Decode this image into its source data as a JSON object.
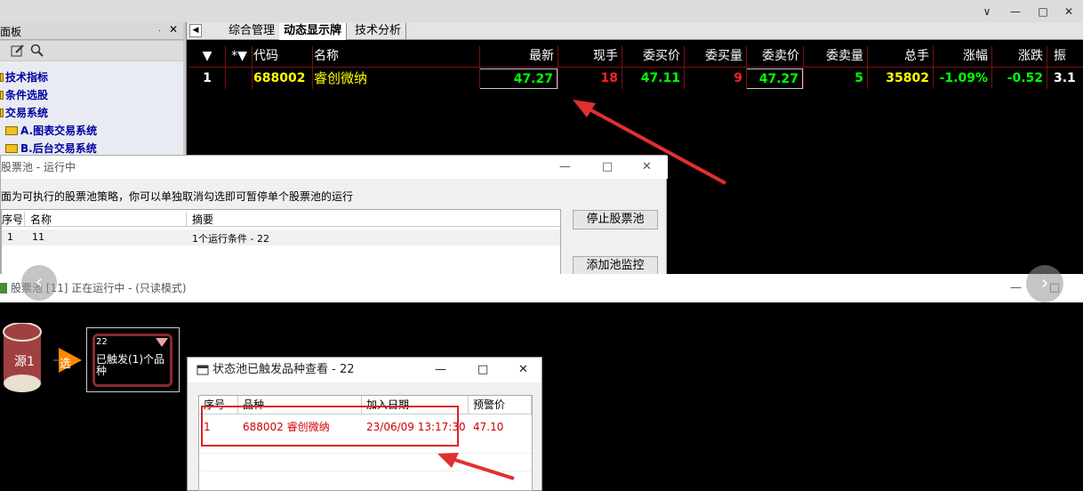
{
  "window": {
    "minimize": "—",
    "restore": "□",
    "close": "✕",
    "chevron": "∨"
  },
  "left_panel": {
    "title": "面板",
    "pin": "ᆞ",
    "close": "✕",
    "items": [
      "技术指标",
      "条件选股",
      "交易系统",
      "A.图表交易系统",
      "B.后台交易系统"
    ]
  },
  "tabs": [
    {
      "label": "综合管理"
    },
    {
      "label": "动态显示牌"
    },
    {
      "label": "技术分析"
    }
  ],
  "tab_arrow": "◀",
  "grid": {
    "headers": [
      "▼",
      "*▼",
      "代码",
      "名称",
      "最新",
      "现手",
      "委买价",
      "委买量",
      "委卖价",
      "委卖量",
      "总手",
      "涨幅",
      "涨跌",
      "振"
    ],
    "row": {
      "index": "1",
      "code": "688002",
      "name": "睿创微纳",
      "latest": "47.27",
      "now_vol": "18",
      "bid": "47.11",
      "bid_vol": "9",
      "ask": "47.27",
      "ask_vol": "5",
      "total": "35802",
      "change_pct": "-1.09%",
      "change": "-0.52",
      "amp": "3.1"
    },
    "colors": {
      "yellow": "#ffff00",
      "green": "#00ff00",
      "red": "#ff2020",
      "white": "#ffffff"
    }
  },
  "pool_window": {
    "title": "股票池  -  运行中",
    "desc": "面为可执行的股票池策略，你可以单独取消勾选即可暂停单个股票池的运行",
    "headers": [
      "序号",
      "名称",
      "摘要"
    ],
    "rows": [
      {
        "no": "1",
        "name": "11",
        "summary": "1个运行条件 - 22"
      }
    ],
    "stop_button": "停止股票池",
    "add_button": "添加池监控"
  },
  "editor_window": {
    "title": "股票池 [11] 正在运行中 -  (只读模式)",
    "source_node": "源1",
    "choose_node": "选",
    "cond_node": {
      "id": "22",
      "text": "已触发(1)个品种"
    }
  },
  "state_dialog": {
    "title": "状态池已触发品种查看 - 22",
    "headers": [
      "序号",
      "品种",
      "加入日期",
      "预警价"
    ],
    "rows": [
      {
        "no": "1",
        "symbol": "688002 睿创微纳",
        "date": "23/06/09 13:17:30",
        "price": "47.10"
      }
    ]
  }
}
